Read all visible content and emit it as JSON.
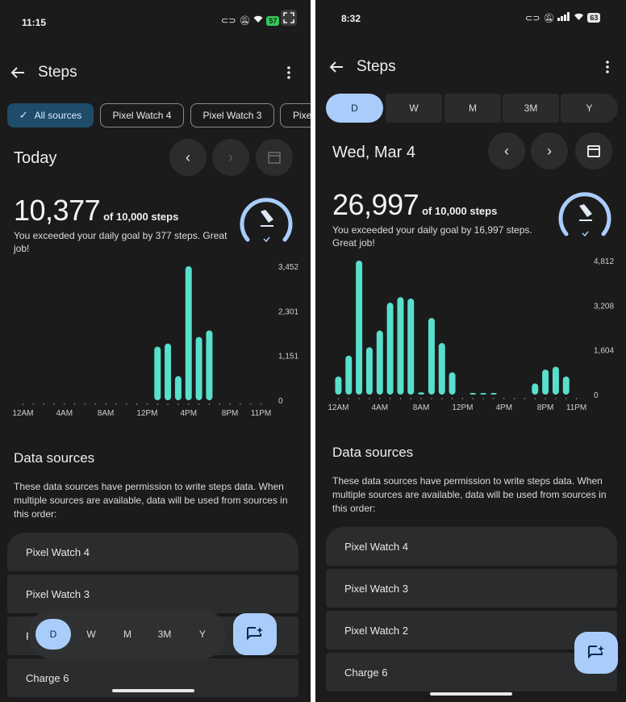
{
  "colors": {
    "accent": "#a9cdfa",
    "bar": "#57e0cc",
    "chip_selected": "#1e4c6a",
    "background": "#1b1b1c",
    "card": "#2b2c2e"
  },
  "left": {
    "status": {
      "time": "11:15",
      "battery": "57",
      "battery_color": "#35c759"
    },
    "header": {
      "title": "Steps"
    },
    "chips": [
      "All sources",
      "Pixel Watch 4",
      "Pixel Watch 3",
      "Pixe"
    ],
    "date_label": "Today",
    "summary": {
      "steps": "10,377",
      "goal": "of 10,000 steps",
      "description": "You exceeded your daily goal by 377 steps. Great job!",
      "goal_progress": 1.0
    },
    "chart_data": {
      "type": "bar",
      "x_tick_labels": [
        "12AM",
        "4AM",
        "8AM",
        "12PM",
        "4PM",
        "8PM",
        "11PM"
      ],
      "y_tick_labels": [
        "3,452",
        "2,301",
        "1,151",
        "0"
      ],
      "ylim": [
        0,
        3452
      ],
      "hours": [
        13,
        14,
        15,
        16,
        17,
        18
      ],
      "values": [
        1380,
        1460,
        620,
        3452,
        1630,
        1800
      ],
      "grid": false
    },
    "data_sources": {
      "title": "Data sources",
      "description": "These data sources have permission to write steps data. When multiple sources are available, data will be used from sources in this order:",
      "items": [
        "Pixel Watch 4",
        "Pixel Watch 3",
        "P",
        "Charge 6"
      ]
    },
    "period_tabs": [
      "D",
      "W",
      "M",
      "3M",
      "Y"
    ]
  },
  "right": {
    "status": {
      "time": "8:32",
      "battery": "63",
      "battery_color": "#e8e8e8"
    },
    "header": {
      "title": "Steps"
    },
    "period_tabs": [
      "D",
      "W",
      "M",
      "3M",
      "Y"
    ],
    "date_label": "Wed, Mar 4",
    "summary": {
      "steps": "26,997",
      "goal": "of 10,000 steps",
      "description": "You exceeded your daily goal by 16,997 steps. Great job!",
      "goal_progress": 1.0
    },
    "chart_data": {
      "type": "bar",
      "x_tick_labels": [
        "12AM",
        "4AM",
        "8AM",
        "12PM",
        "4PM",
        "8PM",
        "11PM"
      ],
      "y_tick_labels": [
        "4,812",
        "3,208",
        "1,604",
        "0"
      ],
      "ylim": [
        0,
        4812
      ],
      "hours": [
        0,
        1,
        2,
        3,
        4,
        5,
        6,
        7,
        8,
        9,
        10,
        11,
        12,
        13,
        14,
        15,
        16,
        17,
        18,
        19,
        20,
        21,
        22,
        23
      ],
      "values": [
        650,
        1400,
        4812,
        1700,
        2300,
        3300,
        3500,
        3450,
        80,
        2750,
        1850,
        800,
        0,
        40,
        40,
        40,
        0,
        0,
        0,
        400,
        900,
        1000,
        650,
        0
      ],
      "grid": false
    },
    "data_sources": {
      "title": "Data sources",
      "description": "These data sources have permission to write steps data. When multiple sources are available, data will be used from sources in this order:",
      "items": [
        "Pixel Watch 4",
        "Pixel Watch 3",
        "Pixel Watch 2",
        "Charge 6"
      ]
    }
  }
}
